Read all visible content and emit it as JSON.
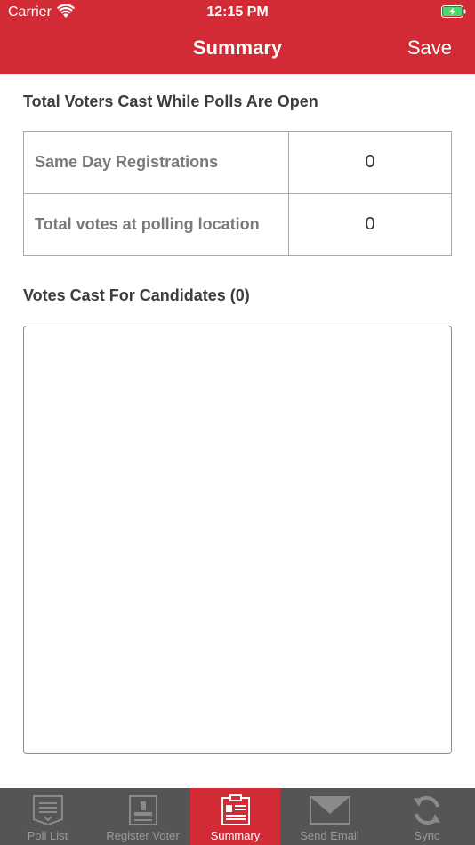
{
  "status_bar": {
    "carrier": "Carrier",
    "time": "12:15 PM"
  },
  "nav": {
    "title": "Summary",
    "save_label": "Save"
  },
  "voters_section": {
    "title": "Total Voters Cast While Polls Are Open",
    "rows": [
      {
        "label": "Same Day Registrations",
        "value": "0"
      },
      {
        "label": "Total votes at polling location",
        "value": "0"
      }
    ]
  },
  "candidates_section": {
    "title": "Votes Cast For Candidates (0)"
  },
  "tabs": [
    {
      "label": "Poll List",
      "icon": "document-list-icon",
      "active": false
    },
    {
      "label": "Register Voter",
      "icon": "person-badge-icon",
      "active": false
    },
    {
      "label": "Summary",
      "icon": "clipboard-icon",
      "active": true
    },
    {
      "label": "Send Email",
      "icon": "envelope-icon",
      "active": false
    },
    {
      "label": "Sync",
      "icon": "sync-arrows-icon",
      "active": false
    }
  ],
  "colors": {
    "accent": "#d22b36",
    "tabbar_bg": "#555555",
    "tab_inactive_text": "#9a9a9a",
    "battery_fill": "#4cd964"
  }
}
